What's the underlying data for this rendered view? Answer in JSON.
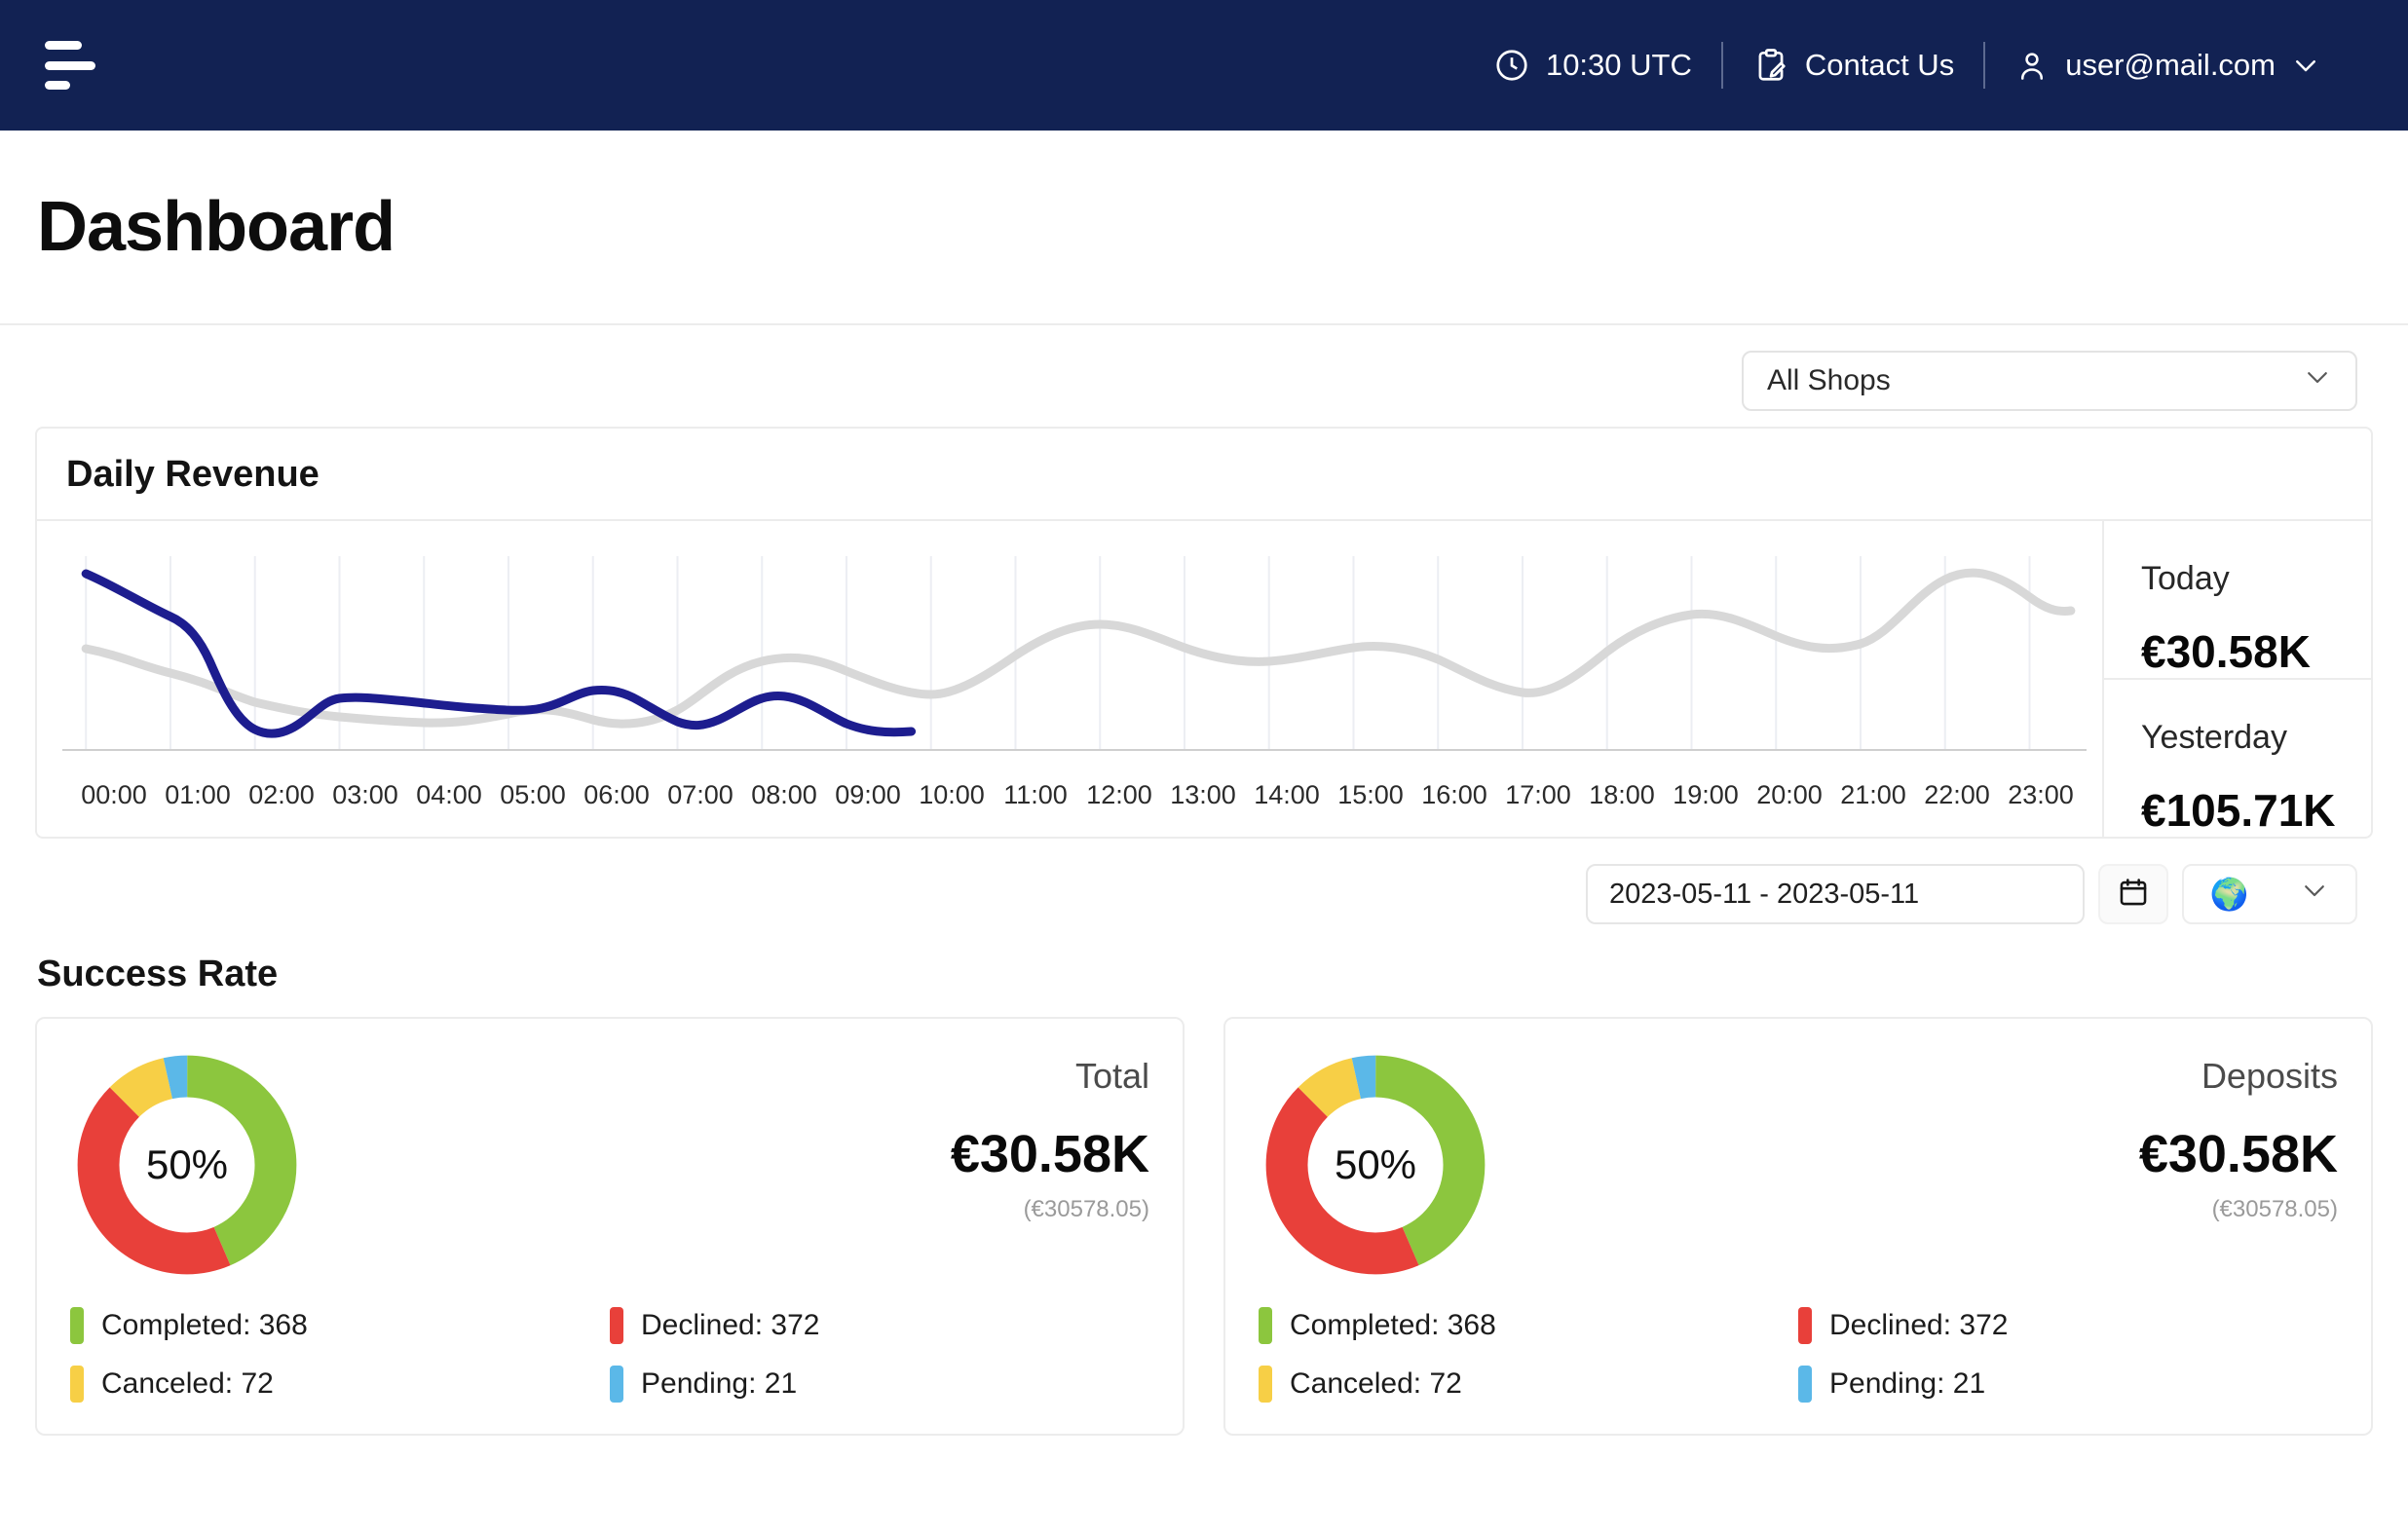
{
  "navbar": {
    "menu_icon": "hamburger-icon",
    "time_icon": "clock-icon",
    "time": "10:30 UTC",
    "contact_icon": "clipboard-pencil-icon",
    "contact_label": "Contact Us",
    "user_icon": "person-icon",
    "user_email": "user@mail.com",
    "user_chevron": "chevron-down-icon"
  },
  "page": {
    "title": "Dashboard"
  },
  "shop_selector": {
    "value": "All Shops",
    "chevron": "chevron-down-icon"
  },
  "revenue": {
    "title": "Daily Revenue",
    "today_label": "Today",
    "today_value": "€30.58K",
    "yesterday_label": "Yesterday",
    "yesterday_value": "€105.71K"
  },
  "date_row": {
    "range": "2023-05-11 - 2023-05-11",
    "calendar_icon": "calendar-icon",
    "globe_icon": "globe-icon",
    "globe_chevron": "chevron-down-icon"
  },
  "success_rate": {
    "title": "Success Rate",
    "cards": [
      {
        "label": "Total",
        "percent": "50%",
        "amount": "€30.58K",
        "amount_exact": "(€30578.05)",
        "legend": [
          {
            "name": "Completed",
            "value": "368",
            "color": "#8cc63e"
          },
          {
            "name": "Declined",
            "value": "372",
            "color": "#e8403a"
          },
          {
            "name": "Canceled",
            "value": "72",
            "color": "#f7cf46"
          },
          {
            "name": "Pending",
            "value": "21",
            "color": "#5bb8e8"
          }
        ]
      },
      {
        "label": "Deposits",
        "percent": "50%",
        "amount": "€30.58K",
        "amount_exact": "(€30578.05)",
        "legend": [
          {
            "name": "Completed",
            "value": "368",
            "color": "#8cc63e"
          },
          {
            "name": "Declined",
            "value": "372",
            "color": "#e8403a"
          },
          {
            "name": "Canceled",
            "value": "72",
            "color": "#f7cf46"
          },
          {
            "name": "Pending",
            "value": "21",
            "color": "#5bb8e8"
          }
        ]
      }
    ]
  },
  "colors": {
    "navbar_bg": "#122253",
    "today_line": "#1d1d8f",
    "yesterday_line": "#d8d8d8",
    "grid": "#eceef3"
  },
  "chart_data": {
    "type": "line",
    "title": "Daily Revenue",
    "xlabel": "",
    "ylabel": "",
    "grid": true,
    "legend_position": "none",
    "categories": [
      "00:00",
      "01:00",
      "02:00",
      "03:00",
      "04:00",
      "05:00",
      "06:00",
      "07:00",
      "08:00",
      "09:00",
      "10:00",
      "11:00",
      "12:00",
      "13:00",
      "14:00",
      "15:00",
      "16:00",
      "17:00",
      "18:00",
      "19:00",
      "20:00",
      "21:00",
      "22:00",
      "23:00"
    ],
    "ylim": [
      0,
      100
    ],
    "series": [
      {
        "name": "Today",
        "color": "#1d1d8f",
        "values": [
          86,
          70,
          11,
          23,
          21,
          20,
          25,
          16,
          24,
          23,
          19,
          null,
          null,
          null,
          null,
          null,
          null,
          null,
          null,
          null,
          null,
          null,
          null,
          null
        ]
      },
      {
        "name": "Yesterday",
        "color": "#d8d8d8",
        "values": [
          53,
          43,
          33,
          27,
          24,
          22,
          25,
          20,
          30,
          45,
          38,
          28,
          50,
          62,
          48,
          55,
          55,
          43,
          60,
          65,
          52,
          88,
          72,
          76
        ]
      }
    ]
  }
}
